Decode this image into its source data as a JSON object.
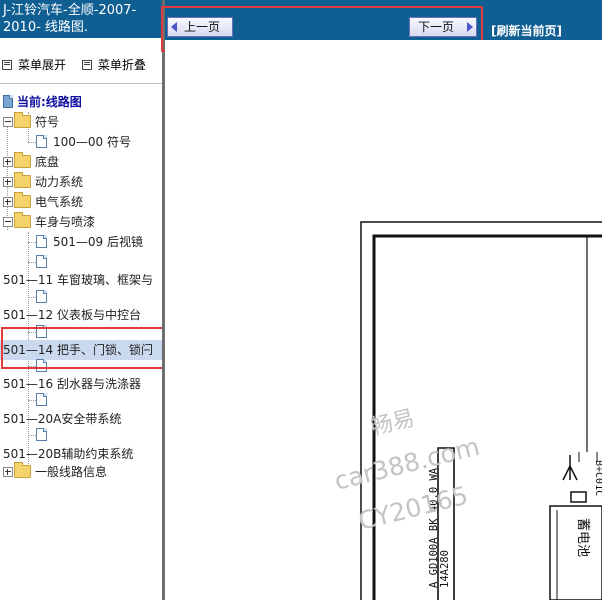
{
  "sidebar": {
    "title": "J-江铃汽车-全顺-2007-2010- 线路图.",
    "menu_expand": "菜单展开",
    "menu_collapse": "菜单折叠",
    "current": "当前:线路图",
    "items": [
      {
        "label": "符号",
        "type": "folder",
        "expanded": true
      },
      {
        "label": "100—00 符号",
        "type": "doc"
      },
      {
        "label": "底盘",
        "type": "folder",
        "expanded": false
      },
      {
        "label": "动力系统",
        "type": "folder",
        "expanded": false
      },
      {
        "label": "电气系统",
        "type": "folder",
        "expanded": false
      },
      {
        "label": "车身与喷漆",
        "type": "folder",
        "expanded": true
      },
      {
        "label": "501—09 后视镜",
        "type": "doc"
      },
      {
        "label": "501—11 车窗玻璃、框架与",
        "type": "doc"
      },
      {
        "label": "501—12 仪表板与中控台",
        "type": "doc"
      },
      {
        "label": "501—14 把手、门锁、锁闩",
        "type": "doc",
        "selected": true
      },
      {
        "label": "501—16 刮水器与洗涤器",
        "type": "doc"
      },
      {
        "label": "501—20A安全带系统",
        "type": "doc"
      },
      {
        "label": "501—20B辅助约束系统",
        "type": "doc"
      },
      {
        "label": "一般线路信息",
        "type": "folder",
        "expanded": false
      }
    ]
  },
  "toolbar": {
    "prev_label": "上一页",
    "next_label": "下一页",
    "refresh_label": "[刷新当前页]"
  },
  "diagram": {
    "watermark_1": "畅易",
    "watermark_2": "car388.com",
    "watermark_3": "CY20165",
    "wire_1": "A GD100A BK 40.0 WA",
    "wire_2": "14A280",
    "connector_label": "B+C01C",
    "box_text": "蓄电池"
  },
  "colors": {
    "header_blue": "#0f5f93",
    "highlight": "#cbd9ee",
    "annotation_red": "#e23a3a"
  }
}
